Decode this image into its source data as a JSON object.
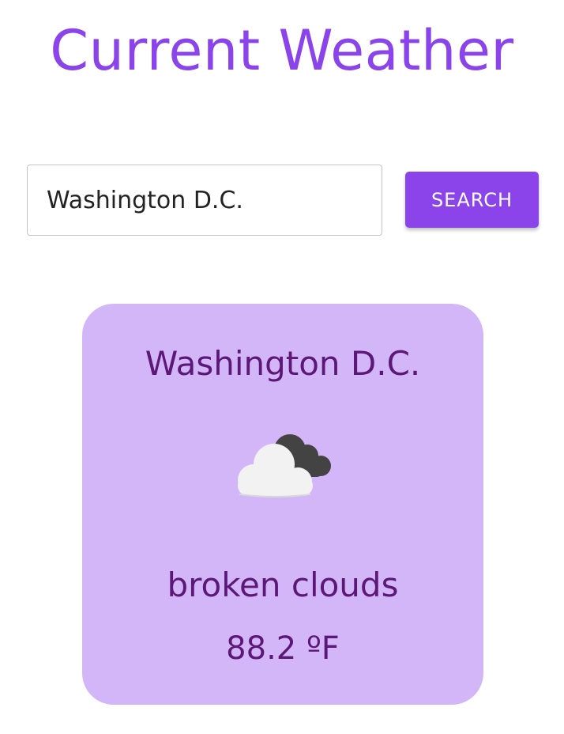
{
  "header": {
    "title": "Current Weather"
  },
  "search": {
    "value": "Washington D.C.",
    "button_label": "SEARCH"
  },
  "weather_card": {
    "city": "Washington D.C.",
    "icon": "broken-clouds-icon",
    "description": "broken clouds",
    "temperature": "88.2 ºF"
  },
  "colors": {
    "accent": "#8a44ea",
    "card_background": "#d3b6f7",
    "card_text": "#5c1777"
  }
}
